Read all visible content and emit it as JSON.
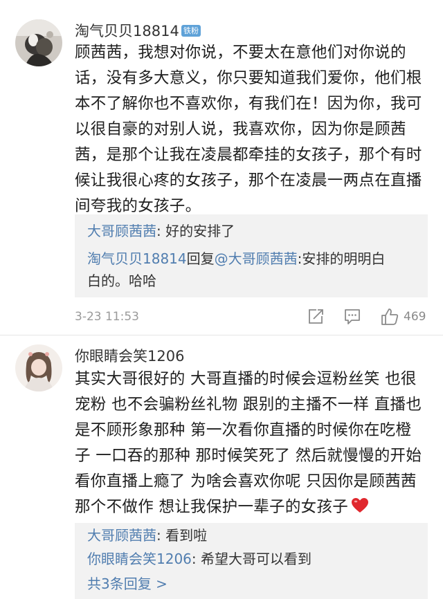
{
  "comments": [
    {
      "username": "淘气贝贝18814",
      "badge": "铁粉",
      "text_lines": [
        "顾茜茜，我想对你说，不要太在意他们对你说的",
        "话，没有多大意义，你只要知道我们爱你，他们根",
        "本不了解你也不喜欢你，有我们在！因为你，我可",
        "以很自豪的对别人说，我喜欢你，因为你是顾茜",
        "茜，是那个让我在凌晨都牵挂的女孩子，那个有时",
        "候让我很心疼的女孩子，那个在凌晨一两点在直播",
        "间夸我的女孩子。"
      ],
      "replies": [
        {
          "user": "大哥顾茜茜",
          "sep": ": ",
          "text": "好的安排了"
        },
        {
          "user": "淘气贝贝18814",
          "mid": "回复",
          "target": "@大哥顾茜茜",
          "sep": ":",
          "text": "安排的明明白",
          "text2": "白的。哈哈"
        }
      ],
      "time": "3-23 11:53",
      "like_count": "469",
      "icons": [
        "share-icon",
        "comment-icon",
        "like-icon"
      ]
    },
    {
      "username": "你眼睛会笑1206",
      "text_lines": [
        "其实大哥很好的 大哥直播的时候会逗粉丝笑 也很",
        "宠粉 也不会骗粉丝礼物 跟别的主播不一样 直播也",
        "是不顾形象那种 第一次看你直播的时候你在吃橙",
        "子 一口吞的那种 那时候笑死了 然后就慢慢的开始",
        "看你直播上瘾了 为啥会喜欢你呢 只因你是顾茜茜",
        "那个不做作 想让我保护一辈子的女孩子"
      ],
      "replies": [
        {
          "user": "大哥顾茜茜",
          "sep": ": ",
          "text": "看到啦"
        },
        {
          "user": "你眼睛会笑1206",
          "sep": ": ",
          "text": "希望大哥可以看到"
        }
      ],
      "more_replies": "共3条回复 >",
      "icons": [
        "heart-icon"
      ]
    }
  ],
  "colors": {
    "link": "#507daf",
    "badge": "#5fa2d8",
    "reply_bg": "#f2f2f2",
    "heart": "#e0282e"
  }
}
